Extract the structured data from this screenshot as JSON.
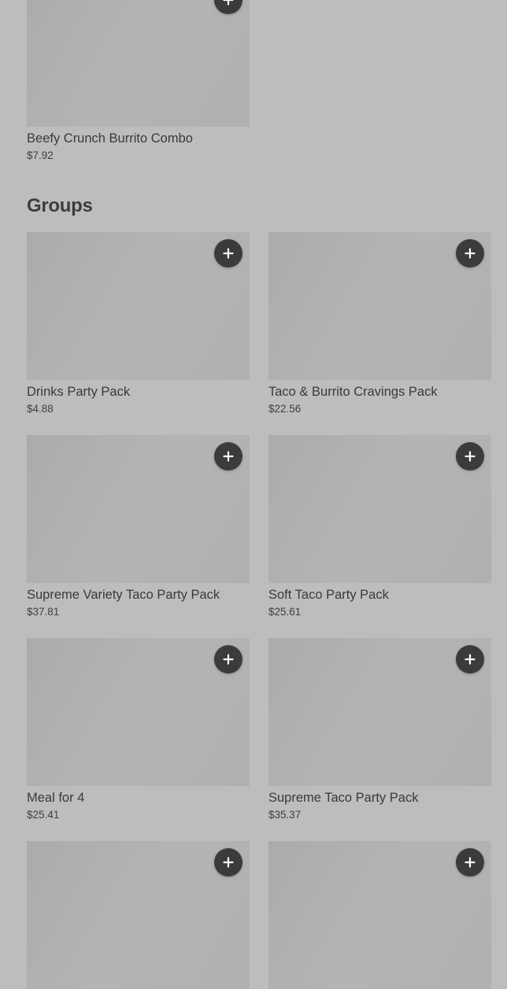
{
  "top_item": {
    "name": "Beefy Crunch Burrito Combo",
    "price": "$7.92"
  },
  "groups": {
    "title": "Groups",
    "items": [
      {
        "name": "Drinks Party Pack",
        "price": "$4.88"
      },
      {
        "name": "Taco & Burrito Cravings Pack",
        "price": "$22.56"
      },
      {
        "name": "Supreme Variety Taco Party Pack",
        "price": "$37.81"
      },
      {
        "name": "Soft Taco Party Pack",
        "price": "$25.61"
      },
      {
        "name": "Meal for 4",
        "price": "$25.41"
      },
      {
        "name": "Supreme Taco Party Pack",
        "price": "$35.37"
      }
    ]
  },
  "colors": {
    "background": "#bdbdbd",
    "image_placeholder": "#b0b0b0",
    "add_button": "#3b3b3b",
    "text": "#3a3a3a"
  },
  "icons": {
    "add": "plus-icon"
  }
}
